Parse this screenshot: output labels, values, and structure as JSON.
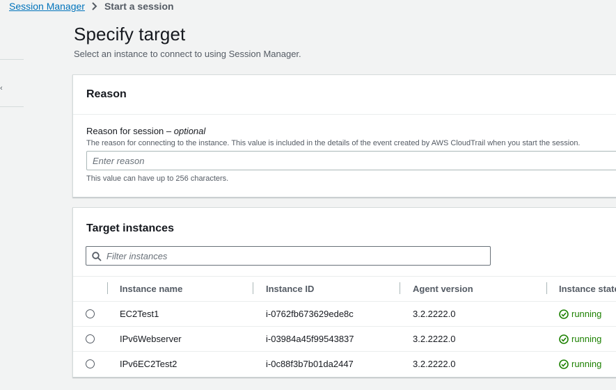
{
  "breadcrumb": {
    "parent": "Session Manager",
    "current": "Start a session"
  },
  "page": {
    "title": "Specify target",
    "description": "Select an instance to connect to using Session Manager."
  },
  "reason": {
    "title": "Reason",
    "label": "Reason for session – ",
    "label_optional": "optional",
    "description": "The reason for connecting to the instance. This value is included in the details of the event created by AWS CloudTrail when you start the session.",
    "placeholder": "Enter reason",
    "constraint": "This value can have up to 256 characters."
  },
  "targets": {
    "title": "Target instances",
    "filter_placeholder": "Filter instances",
    "columns": [
      "Instance name",
      "Instance ID",
      "Agent version",
      "Instance state"
    ],
    "rows": [
      {
        "name": "EC2Test1",
        "id": "i-0762fb673629ede8c",
        "agent": "3.2.2222.0",
        "state": "running"
      },
      {
        "name": "IPv6Webserver",
        "id": "i-03984a45f99543837",
        "agent": "3.2.2222.0",
        "state": "running"
      },
      {
        "name": "IPv6EC2Test2",
        "id": "i-0c88f3b7b01da2447",
        "agent": "3.2.2222.0",
        "state": "running"
      }
    ]
  },
  "colors": {
    "link": "#0073bb",
    "success": "#1d8102",
    "page_bg": "#f2f3f3"
  }
}
